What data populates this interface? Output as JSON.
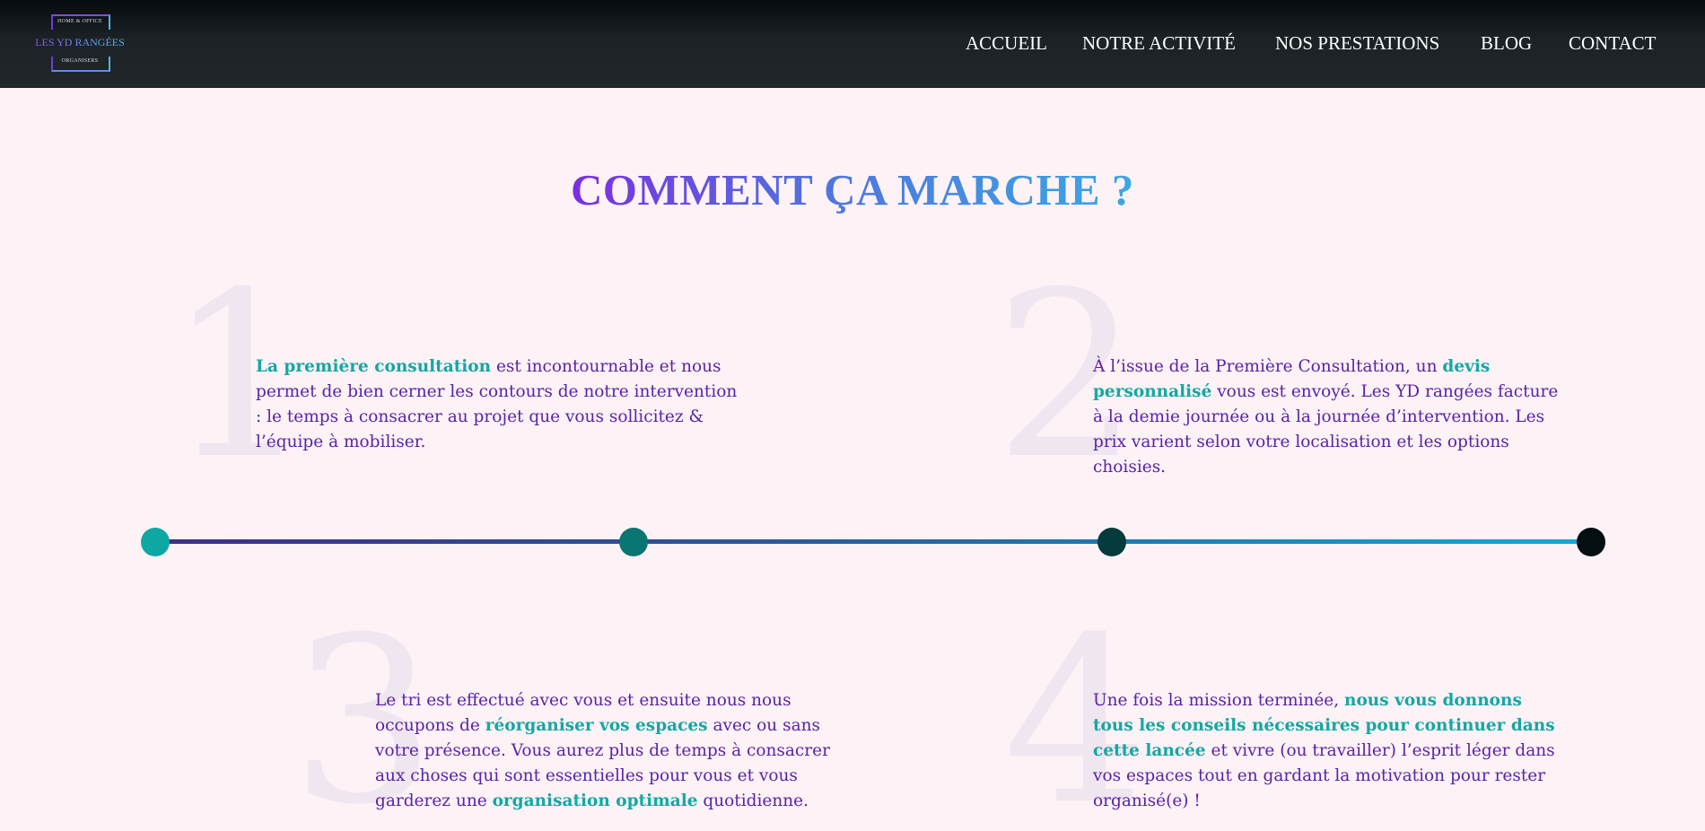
{
  "header": {
    "logo": {
      "tagline_top": "HOME & OFFICE",
      "brand": "LES YD RANGÉES",
      "tagline_bottom": "ORGANISERS"
    },
    "nav": [
      "ACCUEIL",
      "NOTRE ACTIVITÉ",
      "NOS PRESTATIONS",
      "BLOG",
      "CONTACT"
    ]
  },
  "main": {
    "title": "COMMENT ÇA MARCHE ?",
    "steps": [
      {
        "number": "1",
        "highlight_1": "La première consultation",
        "text_1": " est incontournable et nous permet de bien cerner les contours de notre intervention : le temps à consacrer au projet que vous sollicitez & l’équipe à mobiliser."
      },
      {
        "number": "2",
        "text_1": "À l’issue de la Première Consultation, un ",
        "highlight_1": "devis personnalisé",
        "text_2": " vous est envoyé. Les YD rangées facture à la demie journée ou à la journée d’intervention. Les prix varient selon votre localisation et les options choisies."
      },
      {
        "number": "3",
        "text_1": "Le tri est effectué avec vous et ensuite nous nous occupons de ",
        "highlight_1": "réorganiser vos espaces",
        "text_2": " avec ou sans votre présence. Vous aurez plus de temps à consacrer aux choses qui sont essentielles pour vous et vous garderez une ",
        "highlight_2": "organisation optimale",
        "text_3": " quotidienne."
      },
      {
        "number": "4",
        "text_1": "Une fois la mission terminée, ",
        "highlight_1": "nous vous donnons tous les conseils nécessaires pour continuer dans cette lancée",
        "text_2": " et vivre (ou travailler) l’esprit léger dans vos espaces tout en gardant la motivation pour rester organisé(e) !"
      }
    ]
  },
  "colors": {
    "background": "#fdf2f6",
    "header_bg": "#1c2226",
    "accent_teal": "#13a8a4",
    "body_text_purple": "#5a22a8",
    "dot_1": "#0fa7a3",
    "dot_2": "#0b7572",
    "dot_3": "#053c3b",
    "dot_4": "#030f11"
  }
}
